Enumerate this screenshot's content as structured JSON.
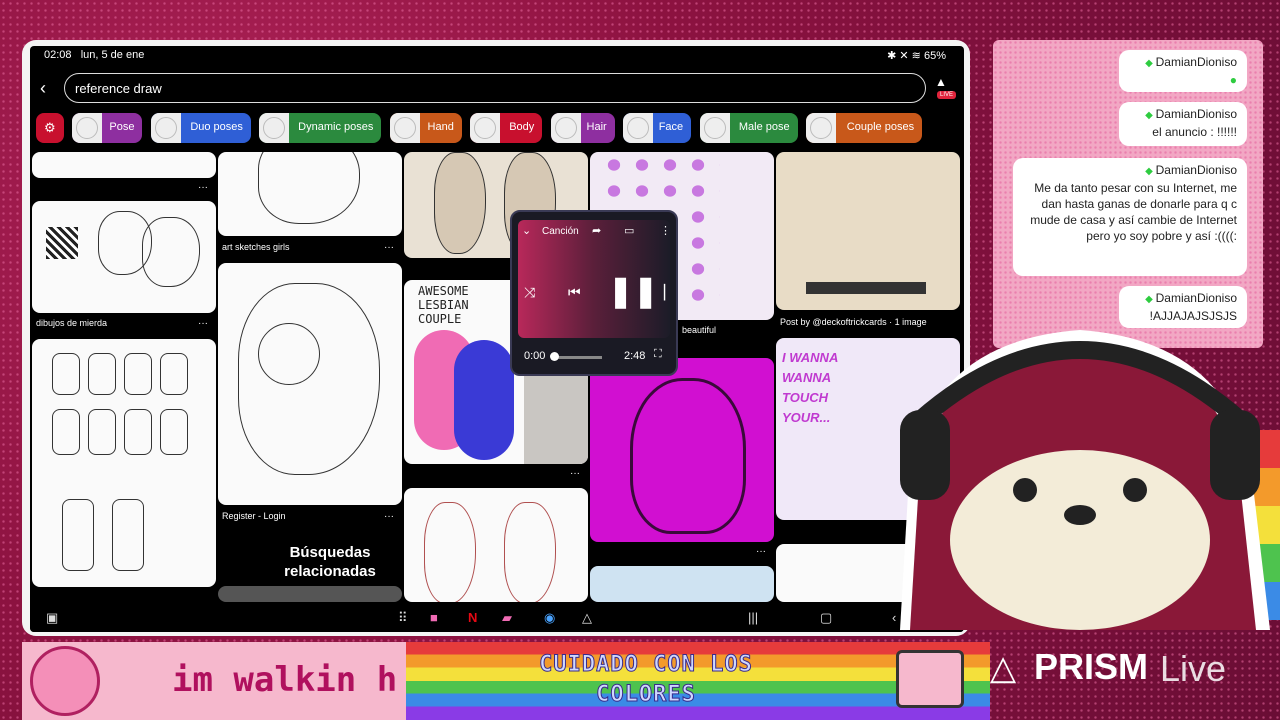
{
  "statusbar": {
    "time": "02:08",
    "date": "lun, 5 de ene",
    "battery": "65%"
  },
  "search": {
    "query": "reference draw",
    "live_badge": "LIVE"
  },
  "chips": [
    {
      "label": "Pose",
      "color": "#8e2fa0"
    },
    {
      "label": "Duo poses",
      "color": "#2f5fd6"
    },
    {
      "label": "Dynamic poses",
      "color": "#2b8a3e"
    },
    {
      "label": "Hand",
      "color": "#c8581a"
    },
    {
      "label": "Body",
      "color": "#c8102e"
    },
    {
      "label": "Hair",
      "color": "#8e2fa0"
    },
    {
      "label": "Face",
      "color": "#2f5fd6"
    },
    {
      "label": "Male pose",
      "color": "#2b8a3e"
    },
    {
      "label": "Couple poses",
      "color": "#c8581a"
    }
  ],
  "pins": {
    "c1_caption": "dibujos de mierda",
    "c2_caption_top": "art sketches girls",
    "c2_caption_mid": "Register - Login",
    "c3_caption": "beautiful",
    "c3_awesome": "AWESOME LESBIAN COUPLE",
    "c4_caption": "Post by @deckoftrickcards · 1 image",
    "c4_wanna": "I WANNA WANNA TOUCH YOUR...",
    "related": "Búsquedas relacionadas",
    "more": "···"
  },
  "player": {
    "title": "Canción",
    "elapsed": "0:00",
    "duration": "2:48",
    "progress": 0.0
  },
  "chat": [
    {
      "name": "DamianDioniso",
      "text": ""
    },
    {
      "name": "DamianDioniso",
      "text": "el anuncio : !!!!!!"
    },
    {
      "name": "DamianDioniso",
      "text": "Me da tanto pesar con su Internet, me dan hasta ganas de donarle para q c mude de casa y así cambie de Internet pero yo soy pobre y así :((((:"
    },
    {
      "name": "DamianDioniso",
      "text": "!AJJAJAJSJSJS"
    }
  ],
  "banner": {
    "walkin": "im walkin h",
    "cuidado": "CUIDADO CON LOS COLORES",
    "prism_name": "PRISM",
    "prism_live": "Live"
  }
}
